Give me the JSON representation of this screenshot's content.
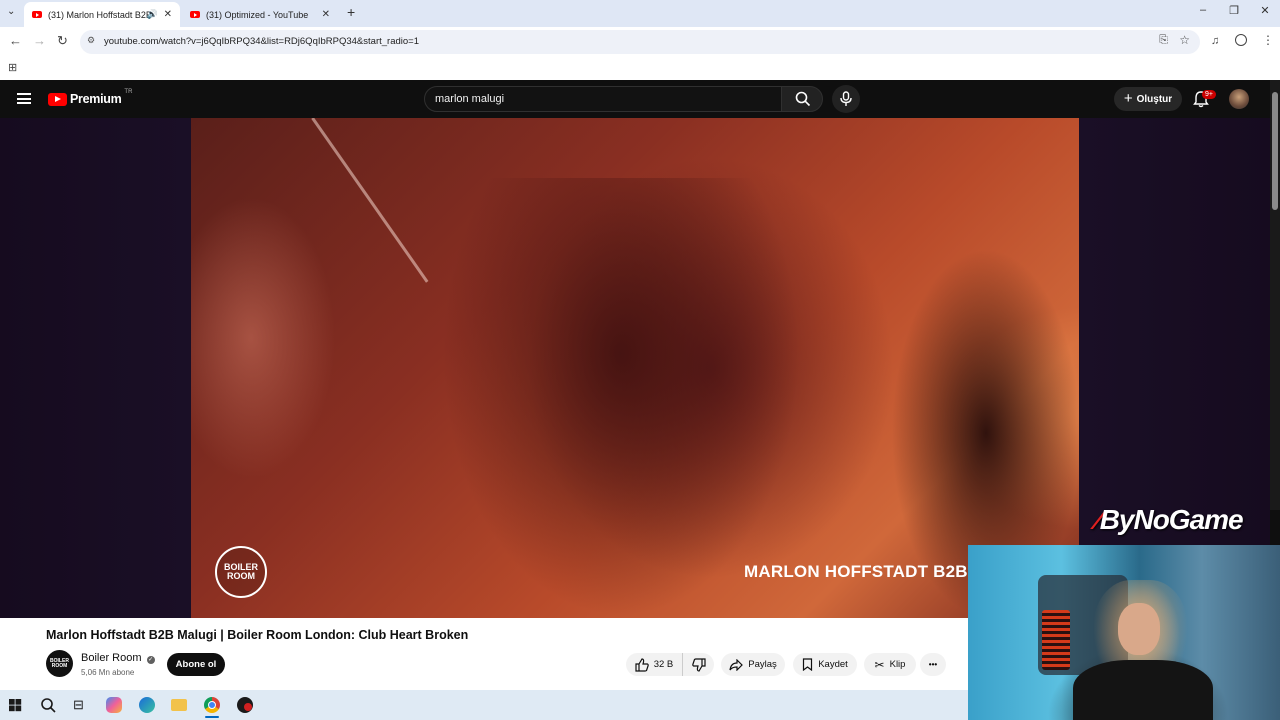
{
  "browser": {
    "tabs": [
      {
        "title": "(31) Marlon Hoffstadt B2B",
        "active": true
      },
      {
        "title": "(31) Optimized - YouTube",
        "active": false
      }
    ],
    "new_tab": "+",
    "url": "youtube.com/watch?v=j6QqIbRPQ34&list=RDj6QqIbRPQ34&start_radio=1",
    "window_controls": {
      "minimize": "–",
      "maximize": "❐",
      "close": "✕"
    }
  },
  "youtube": {
    "logo_text": "Premium",
    "logo_region": "TR",
    "search_value": "marlon malugi",
    "create_label": "Oluştur",
    "notification_count": "9+"
  },
  "video": {
    "overlay_logo": "BOILER ROOM",
    "caption": "MARLON HOFFSTADT B2B",
    "title": "Marlon Hoffstadt B2B Malugi | Boiler Room London: Club Heart Broken",
    "channel": {
      "avatar_text": "BOILER ROOM",
      "name": "Boiler Room",
      "subscribers": "5,06 Mn abone"
    },
    "subscribe_label": "Abone ol",
    "actions": {
      "likes": "32 B",
      "share": "Paylaş",
      "save": "Kaydet",
      "clip": "Klip",
      "more": "•••"
    }
  },
  "webcam": {
    "brand": "ByNoGame"
  },
  "colors": {
    "youtube_red": "#ff0000",
    "header_bg": "#0f0f0f",
    "notification_red": "#cc0000"
  },
  "icons": [
    "menu-icon",
    "youtube-logo-icon",
    "search-icon",
    "mic-icon",
    "plus-icon",
    "bell-icon",
    "like-icon",
    "dislike-icon",
    "share-icon",
    "save-icon",
    "scissors-icon",
    "windows-icon",
    "taskbar-search-icon",
    "edge-icon",
    "chrome-icon",
    "folder-icon"
  ]
}
